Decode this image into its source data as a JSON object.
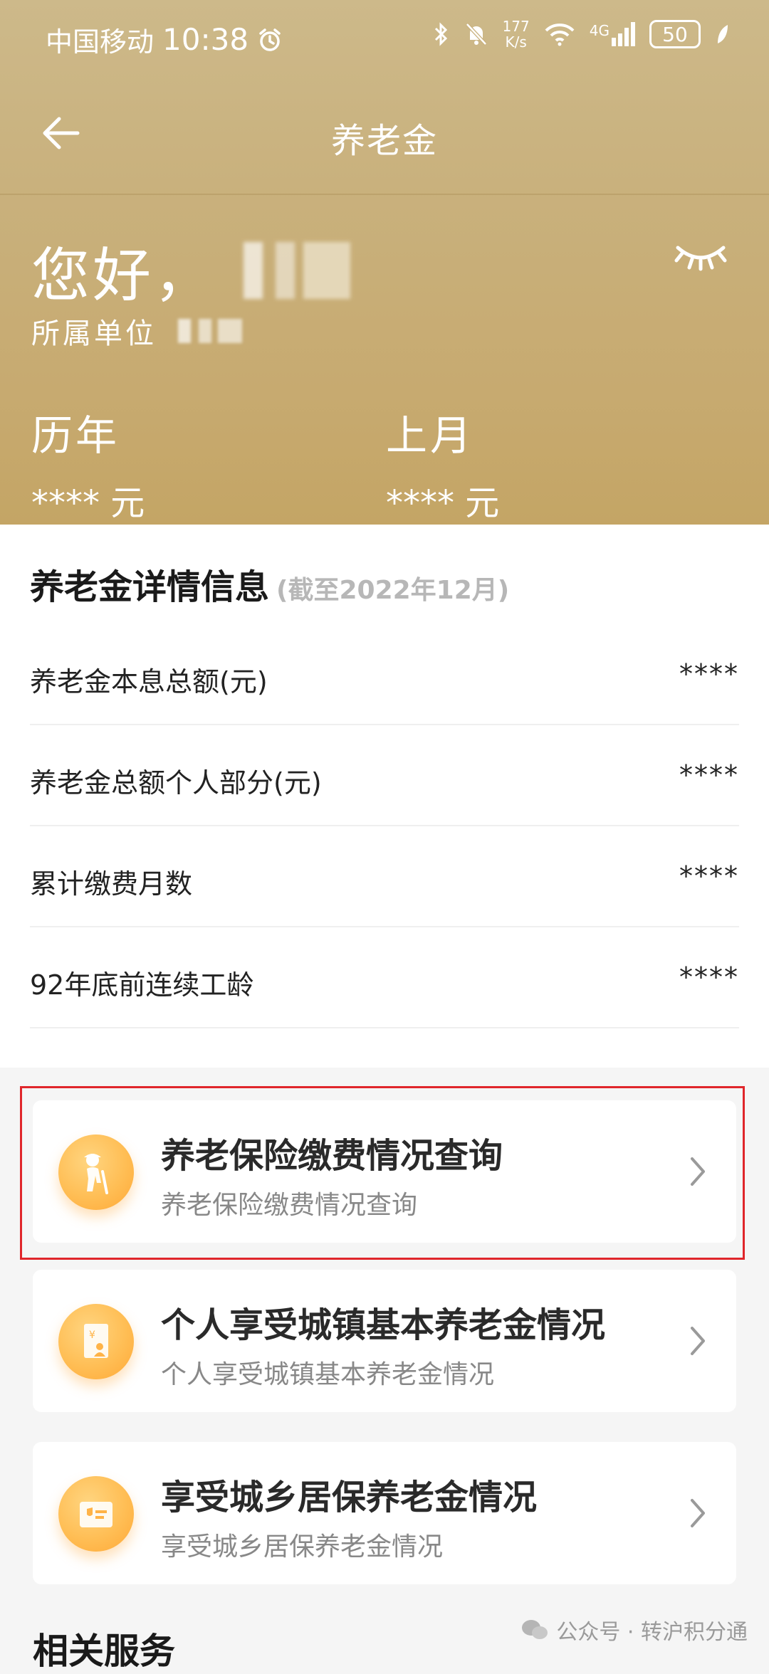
{
  "status_bar": {
    "carrier": "中国移动",
    "time": "10:38",
    "speed_value": "177",
    "speed_unit": "K/s",
    "network": "4G",
    "battery": "50"
  },
  "nav": {
    "title": "养老金"
  },
  "profile": {
    "greeting": "您好，",
    "unit_label": "所属单位"
  },
  "stats": [
    {
      "label": "历年",
      "value": "**** 元"
    },
    {
      "label": "上月",
      "value": "**** 元"
    }
  ],
  "details": {
    "title": "养老金详情信息",
    "note": "(截至2022年12月)",
    "rows": [
      {
        "label": "养老金本息总额(元)",
        "value": "****"
      },
      {
        "label": "养老金总额个人部分(元)",
        "value": "****"
      },
      {
        "label": "累计缴费月数",
        "value": "****"
      },
      {
        "label": "92年底前连续工龄",
        "value": "****"
      }
    ]
  },
  "services": [
    {
      "title": "养老保险缴费情况查询",
      "subtitle": "养老保险缴费情况查询",
      "icon": "elderly-person-icon"
    },
    {
      "title": "个人享受城镇基本养老金情况",
      "subtitle": "个人享受城镇基本养老金情况",
      "icon": "pension-book-icon"
    },
    {
      "title": "享受城乡居保养老金情况",
      "subtitle": "享受城乡居保养老金情况",
      "icon": "insurance-card-icon"
    }
  ],
  "related": {
    "title": "相关服务"
  },
  "watermark": {
    "text": "公众号 · 转沪积分通"
  },
  "colors": {
    "header_gold": "#c9b17d",
    "highlight_red": "#e0262b",
    "icon_orange": "#ffbe55"
  }
}
